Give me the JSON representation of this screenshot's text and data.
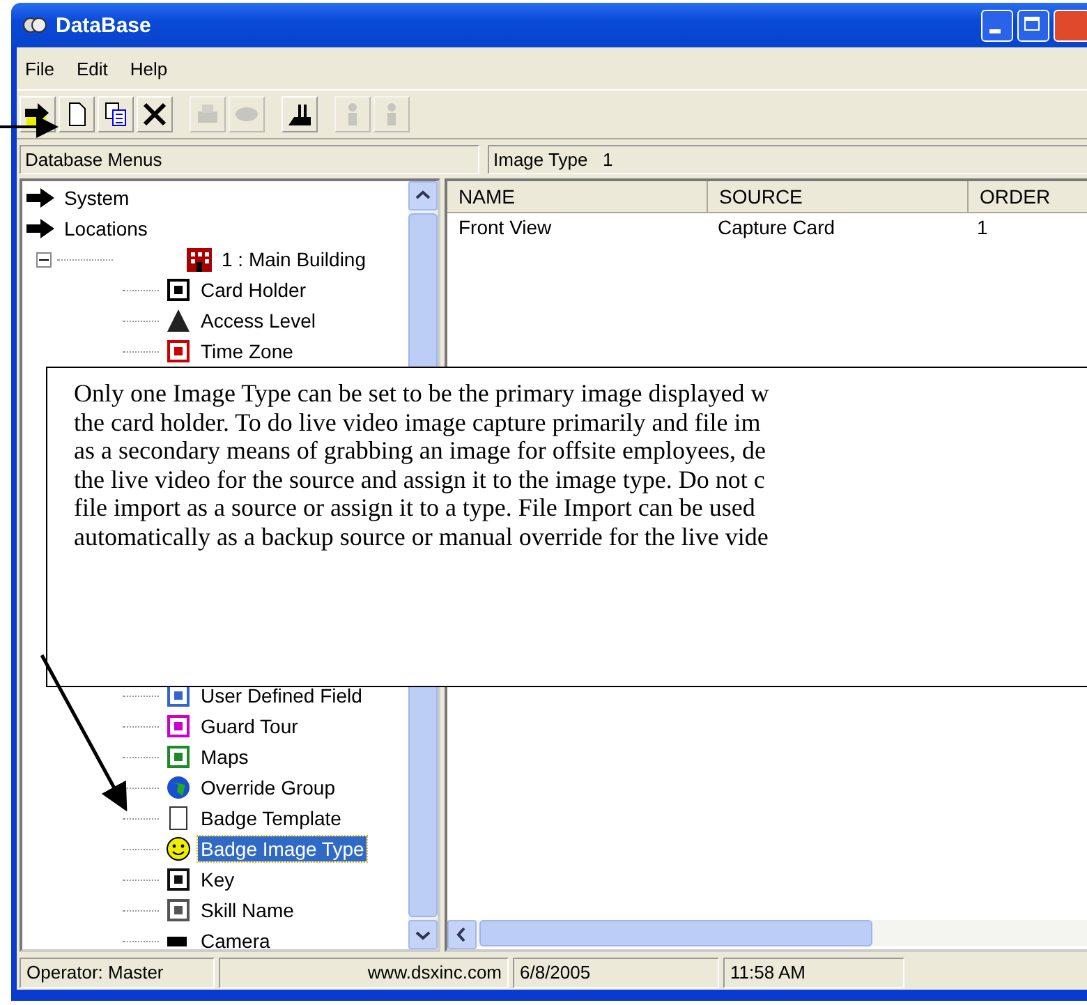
{
  "window": {
    "title": "DataBase"
  },
  "menu": [
    {
      "label": "File"
    },
    {
      "label": "Edit"
    },
    {
      "label": "Help"
    }
  ],
  "toolbar": [
    {
      "disabled": false
    },
    {
      "disabled": false
    },
    {
      "disabled": false
    },
    {
      "disabled": false
    },
    {
      "disabled": true
    },
    {
      "disabled": true
    },
    {
      "disabled": false
    },
    {
      "disabled": true
    },
    {
      "disabled": true
    }
  ],
  "sidebar": {
    "header": "Database Menus",
    "tree": [
      {
        "label": "System",
        "selected": false
      },
      {
        "label": "Locations",
        "selected": false
      },
      {
        "label": "1 : Main Building",
        "selected": false,
        "expanded": true,
        "children": [
          {
            "label": "Card Holder",
            "selected": false
          },
          {
            "label": "Access Level",
            "selected": false
          },
          {
            "label": "Time Zone",
            "selected": false
          },
          {
            "label": "User Defined Field",
            "selected": false
          },
          {
            "label": "Guard Tour",
            "selected": false
          },
          {
            "label": "Maps",
            "selected": false
          },
          {
            "label": "Override Group",
            "selected": false
          },
          {
            "label": "Badge Template",
            "selected": false
          },
          {
            "label": "Badge Image Type",
            "selected": true
          },
          {
            "label": "Key",
            "selected": false
          },
          {
            "label": "Skill Name",
            "selected": false
          },
          {
            "label": "Camera",
            "selected": false
          }
        ]
      }
    ]
  },
  "panel": {
    "header": "Image Type   1",
    "table": {
      "columns": [
        "NAME",
        "SOURCE",
        "ORDER"
      ],
      "rows": [
        [
          "Front View",
          "Capture Card",
          "1"
        ]
      ]
    }
  },
  "callout": {
    "lines": [
      "Only one Image Type can be set to be the primary image displayed w",
      "the card holder. To do live video image capture primarily and file im",
      "as a secondary means of grabbing an image for offsite employees, de",
      "the live video for the source and assign it to the image type. Do not c",
      "file import as a source or assign it to a type. File Import can be used",
      "automatically as a backup source or manual override for the live vide"
    ]
  },
  "status_bar": {
    "operator": "Operator:  Master",
    "website": "www.dsxinc.com",
    "date": "6/8/2005",
    "time": "11:58 AM"
  }
}
